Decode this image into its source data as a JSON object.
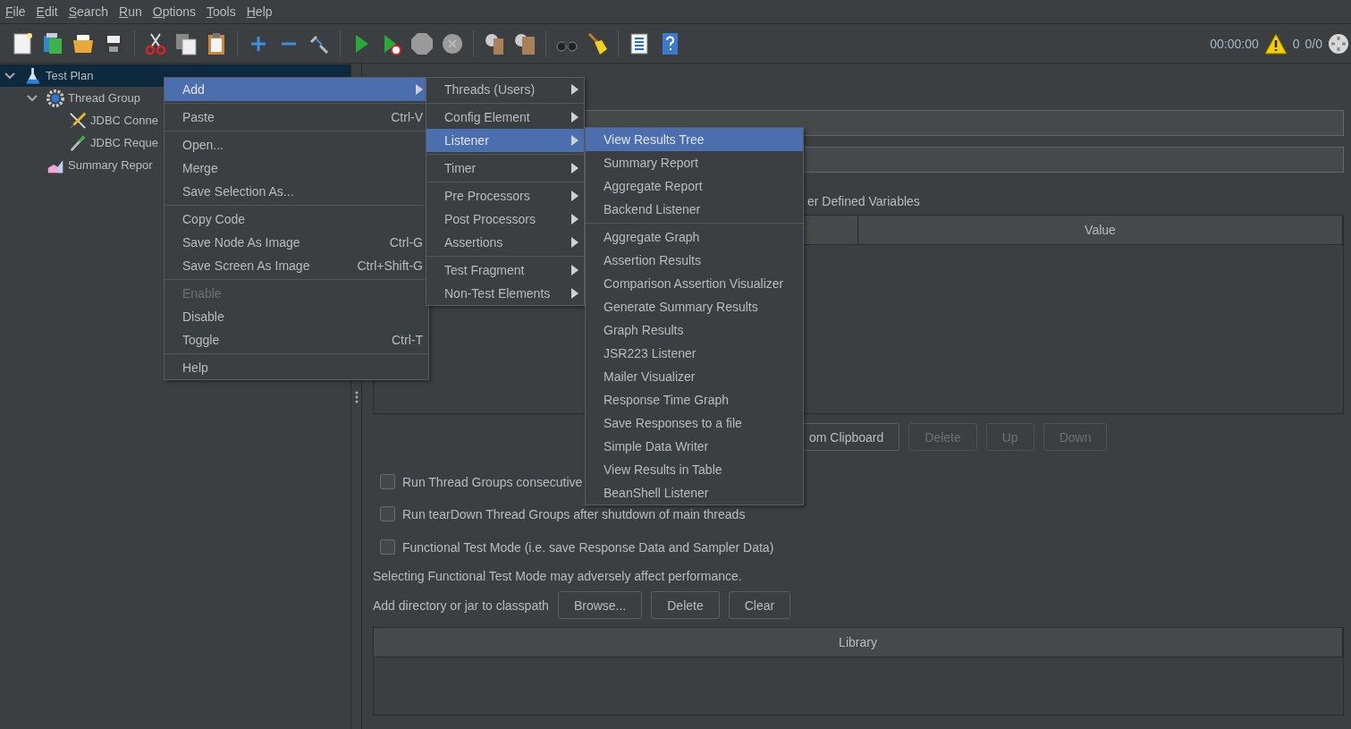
{
  "menubar": [
    "File",
    "Edit",
    "Search",
    "Run",
    "Options",
    "Tools",
    "Help"
  ],
  "status": {
    "timer": "00:00:00",
    "warnings": "0",
    "threads": "0/0"
  },
  "tree": [
    {
      "label": "Test Plan",
      "kind": "plan",
      "selected": true,
      "expanded": true,
      "children": [
        {
          "label": "Thread Group",
          "kind": "threads",
          "selected": false,
          "expanded": true,
          "children": [
            {
              "label": "JDBC Conne",
              "kind": "config",
              "selected": false
            },
            {
              "label": "JDBC Reque",
              "kind": "sampler",
              "selected": false
            }
          ]
        },
        {
          "label": "Summary Repor",
          "kind": "listener",
          "selected": false
        }
      ]
    }
  ],
  "panel": {
    "udv_label": "er Defined Variables",
    "table_columns": [
      "",
      "Value"
    ],
    "table_buttons": [
      {
        "label": "om Clipboard",
        "disabled": false
      },
      {
        "label": "Delete",
        "disabled": true
      },
      {
        "label": "Up",
        "disabled": true
      },
      {
        "label": "Down",
        "disabled": true
      }
    ],
    "checkboxes": [
      {
        "label": "Run Thread Groups consecutive",
        "checked": false
      },
      {
        "label": "Run tearDown Thread Groups after shutdown of main threads",
        "checked": false
      },
      {
        "label": "Functional Test Mode (i.e. save Response Data and Sampler Data)",
        "checked": false
      }
    ],
    "note": "Selecting Functional Test Mode may adversely affect performance.",
    "classpath_label": "Add directory or jar to classpath",
    "classpath_buttons": [
      "Browse...",
      "Delete",
      "Clear"
    ],
    "library_column": "Library"
  },
  "menus": [
    {
      "items": [
        {
          "kind": "item",
          "label": "Add",
          "submenu": true,
          "selected": true,
          "disabled": false
        },
        {
          "kind": "separator"
        },
        {
          "kind": "item",
          "label": "Paste",
          "shortcut": "Ctrl-V",
          "selected": false,
          "disabled": false
        },
        {
          "kind": "separator"
        },
        {
          "kind": "item",
          "label": "Open...",
          "selected": false,
          "disabled": false
        },
        {
          "kind": "item",
          "label": "Merge",
          "selected": false,
          "disabled": false
        },
        {
          "kind": "item",
          "label": "Save Selection As...",
          "selected": false,
          "disabled": false
        },
        {
          "kind": "separator"
        },
        {
          "kind": "item",
          "label": "Copy Code",
          "selected": false,
          "disabled": false
        },
        {
          "kind": "item",
          "label": "Save Node As Image",
          "shortcut": "Ctrl-G",
          "selected": false,
          "disabled": false
        },
        {
          "kind": "item",
          "label": "Save Screen As Image",
          "shortcut": "Ctrl+Shift-G",
          "selected": false,
          "disabled": false
        },
        {
          "kind": "separator"
        },
        {
          "kind": "item",
          "label": "Enable",
          "selected": false,
          "disabled": true
        },
        {
          "kind": "item",
          "label": "Disable",
          "selected": false,
          "disabled": false
        },
        {
          "kind": "item",
          "label": "Toggle",
          "shortcut": "Ctrl-T",
          "selected": false,
          "disabled": false
        },
        {
          "kind": "separator"
        },
        {
          "kind": "item",
          "label": "Help",
          "selected": false,
          "disabled": false
        }
      ]
    },
    {
      "items": [
        {
          "kind": "item",
          "label": "Threads (Users)",
          "submenu": true,
          "selected": false
        },
        {
          "kind": "separator"
        },
        {
          "kind": "item",
          "label": "Config Element",
          "submenu": true,
          "selected": false
        },
        {
          "kind": "item",
          "label": "Listener",
          "submenu": true,
          "selected": true
        },
        {
          "kind": "separator"
        },
        {
          "kind": "item",
          "label": "Timer",
          "submenu": true,
          "selected": false
        },
        {
          "kind": "separator"
        },
        {
          "kind": "item",
          "label": "Pre Processors",
          "submenu": true,
          "selected": false
        },
        {
          "kind": "item",
          "label": "Post Processors",
          "submenu": true,
          "selected": false
        },
        {
          "kind": "item",
          "label": "Assertions",
          "submenu": true,
          "selected": false
        },
        {
          "kind": "separator"
        },
        {
          "kind": "item",
          "label": "Test Fragment",
          "submenu": true,
          "selected": false
        },
        {
          "kind": "item",
          "label": "Non-Test Elements",
          "submenu": true,
          "selected": false
        }
      ]
    },
    {
      "items": [
        {
          "kind": "item",
          "label": "View Results Tree",
          "selected": true
        },
        {
          "kind": "item",
          "label": "Summary Report",
          "selected": false
        },
        {
          "kind": "item",
          "label": "Aggregate Report",
          "selected": false
        },
        {
          "kind": "item",
          "label": "Backend Listener",
          "selected": false
        },
        {
          "kind": "separator"
        },
        {
          "kind": "item",
          "label": "Aggregate Graph",
          "selected": false
        },
        {
          "kind": "item",
          "label": "Assertion Results",
          "selected": false
        },
        {
          "kind": "item",
          "label": "Comparison Assertion Visualizer",
          "selected": false
        },
        {
          "kind": "item",
          "label": "Generate Summary Results",
          "selected": false
        },
        {
          "kind": "item",
          "label": "Graph Results",
          "selected": false
        },
        {
          "kind": "item",
          "label": "JSR223 Listener",
          "selected": false
        },
        {
          "kind": "item",
          "label": "Mailer Visualizer",
          "selected": false
        },
        {
          "kind": "item",
          "label": "Response Time Graph",
          "selected": false
        },
        {
          "kind": "item",
          "label": "Save Responses to a file",
          "selected": false
        },
        {
          "kind": "item",
          "label": "Simple Data Writer",
          "selected": false
        },
        {
          "kind": "item",
          "label": "View Results in Table",
          "selected": false
        },
        {
          "kind": "item",
          "label": "BeanShell Listener",
          "selected": false
        }
      ]
    }
  ]
}
